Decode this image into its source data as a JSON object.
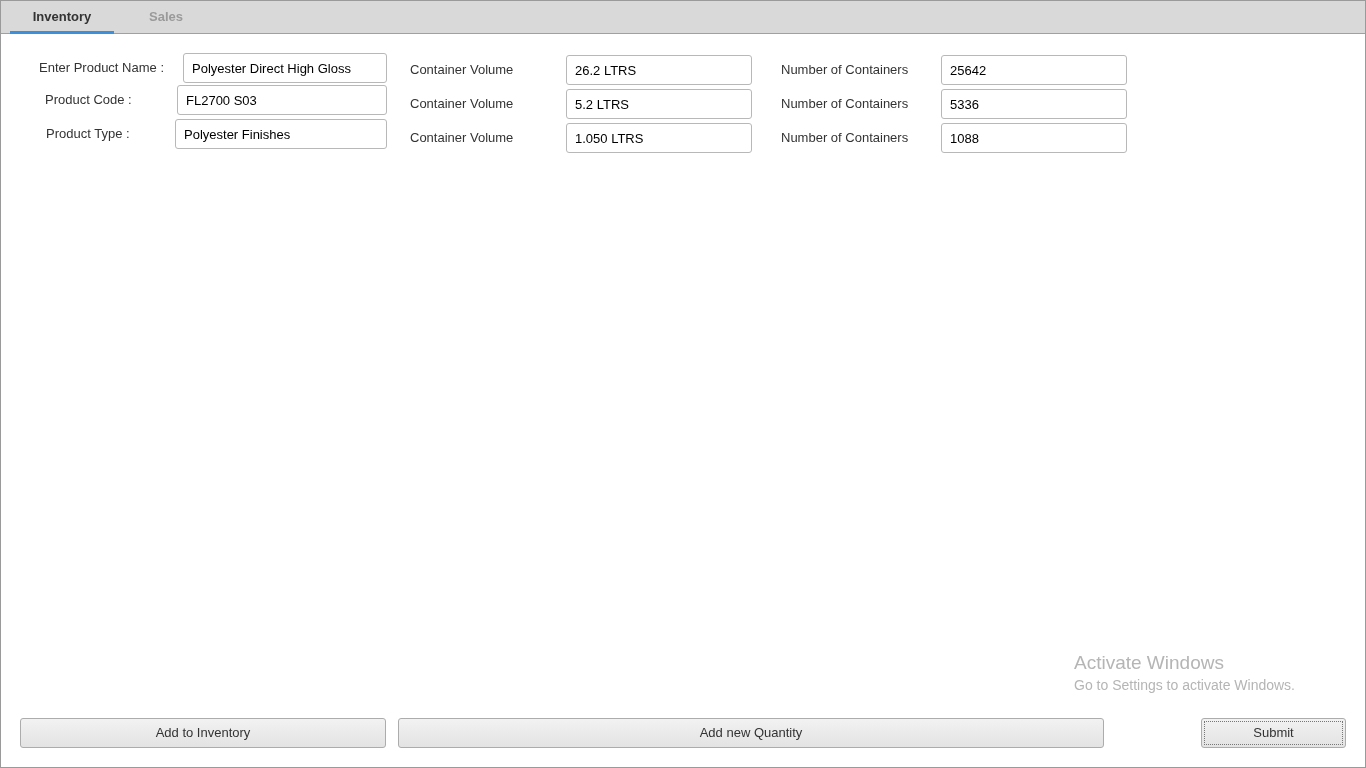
{
  "tabs": [
    {
      "label": "Inventory",
      "selected": true
    },
    {
      "label": "Sales",
      "selected": false
    }
  ],
  "product_fields": [
    {
      "label": "Enter Product Name :",
      "value": "Polyester Direct High Gloss"
    },
    {
      "label": "Product Code :",
      "value": "FL2700 S03"
    },
    {
      "label": "Product Type :",
      "value": "Polyester Finishes"
    }
  ],
  "containers": [
    {
      "volume_label": "Container Volume",
      "volume": "26.2 LTRS",
      "count_label": "Number of Containers",
      "count": "25642"
    },
    {
      "volume_label": "Container Volume",
      "volume": "5.2 LTRS",
      "count_label": "Number of Containers",
      "count": "5336"
    },
    {
      "volume_label": "Container Volume",
      "volume": "1.050 LTRS",
      "count_label": "Number of Containers",
      "count": "1088"
    }
  ],
  "buttons": [
    {
      "label": "Add to Inventory",
      "focused": false
    },
    {
      "label": "Add new Quantity",
      "focused": false
    },
    {
      "label": "Submit",
      "focused": true
    }
  ],
  "activation_notice": {
    "title": "Activate Windows",
    "message": "Go to Settings to activate Windows."
  }
}
